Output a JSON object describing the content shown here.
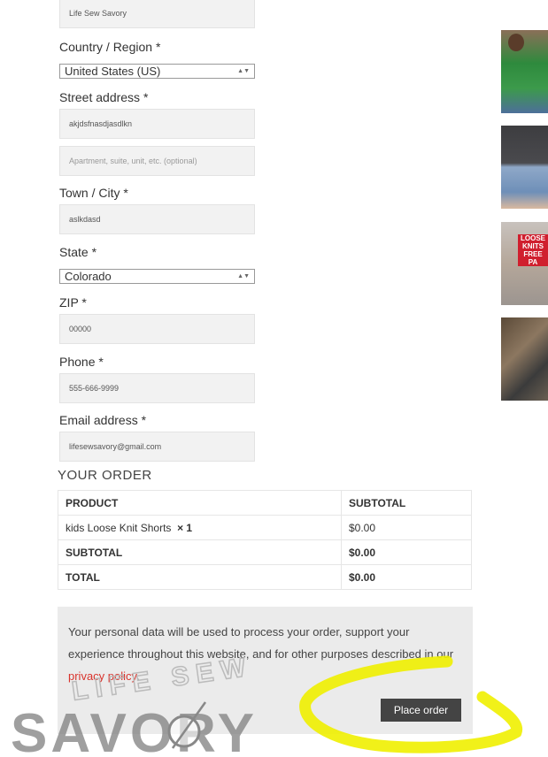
{
  "form": {
    "company_value": "Life Sew Savory",
    "country": {
      "label": "Country / Region *",
      "value": "United States (US)"
    },
    "street": {
      "label": "Street address *",
      "value": "akjdsfnasdjasdlkn",
      "placeholder2": "Apartment, suite, unit, etc. (optional)"
    },
    "town": {
      "label": "Town / City *",
      "value": "aslkdasd"
    },
    "state": {
      "label": "State *",
      "value": "Colorado"
    },
    "zip": {
      "label": "ZIP *",
      "value": "00000"
    },
    "phone": {
      "label": "Phone *",
      "value": "555-666-9999"
    },
    "email": {
      "label": "Email address *",
      "value": "lifesewsavory@gmail.com"
    }
  },
  "order": {
    "heading": "YOUR ORDER",
    "col_product": "PRODUCT",
    "col_subtotal": "SUBTOTAL",
    "item_name": "kids Loose Knit Shorts",
    "item_qty": "× 1",
    "item_price": "$0.00",
    "subtotal_label": "SUBTOTAL",
    "subtotal_value": "$0.00",
    "total_label": "TOTAL",
    "total_value": "$0.00"
  },
  "privacy": {
    "text_before": "Your personal data will be used to process your order, support your experience throughout this website, and for other purposes described in our ",
    "link": "privacy policy",
    "text_after": "."
  },
  "place_order_label": "Place order",
  "watermark": {
    "top": "LIFE SEW",
    "main": "SAVORY"
  },
  "colors": {
    "link": "#d9332c",
    "highlight": "#f0f000",
    "button": "#444444"
  },
  "sidebar_thumbnails": [
    "thumbnail-1",
    "thumbnail-2",
    "thumbnail-3",
    "thumbnail-4"
  ],
  "thumb_texts": {
    "t1": "LOOSE KNITS FREE PA"
  }
}
